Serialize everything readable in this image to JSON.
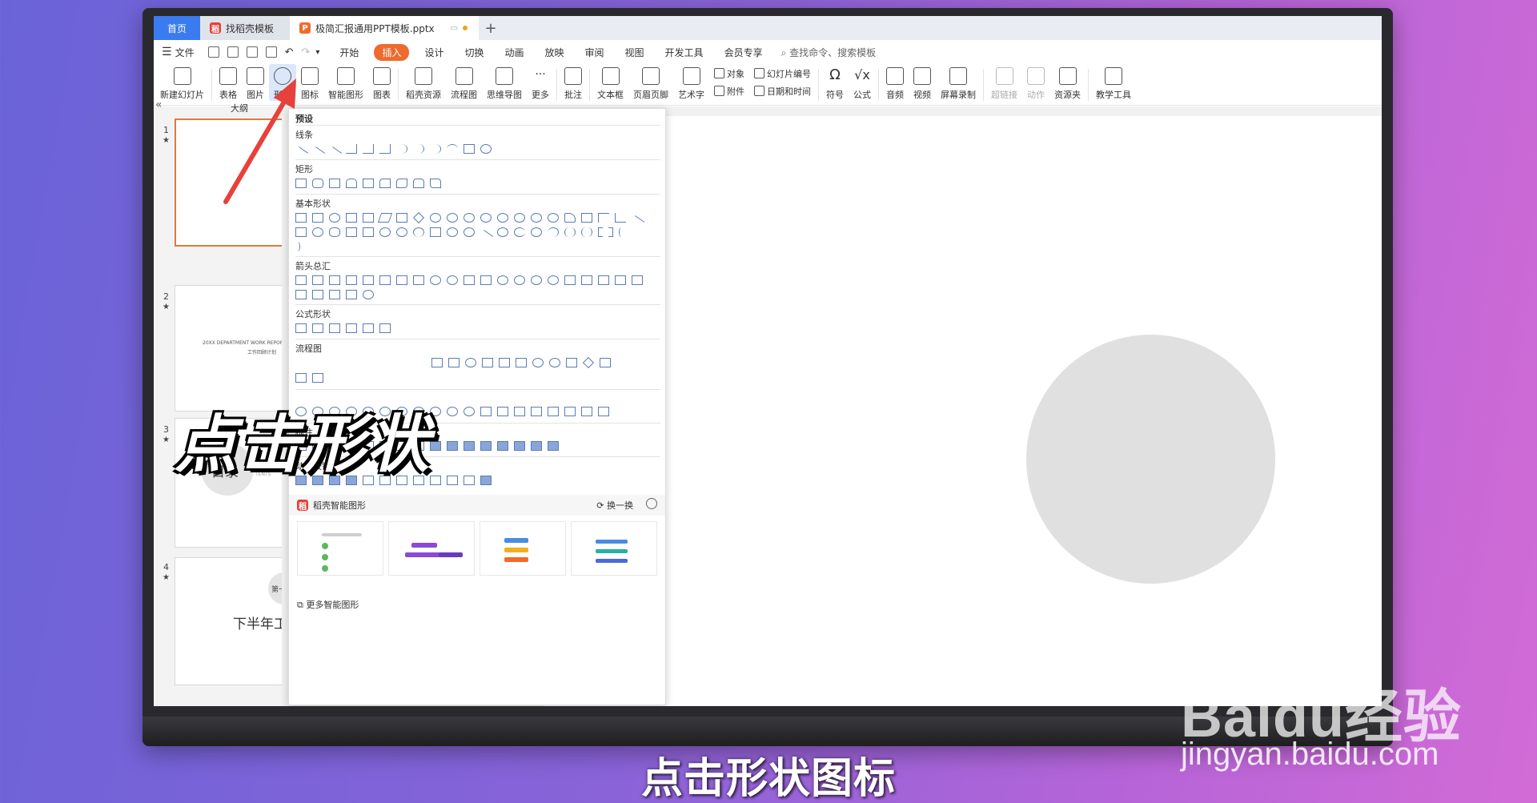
{
  "tabs": {
    "home": "首页",
    "find_template": "找稻壳模板",
    "document": "极简汇报通用PPT模板.pptx"
  },
  "menu": {
    "file": "文件",
    "items": [
      "开始",
      "插入",
      "设计",
      "切换",
      "动画",
      "放映",
      "审阅",
      "视图",
      "开发工具",
      "会员专享"
    ],
    "active": "插入",
    "search_placeholder": "查找命令、搜索模板"
  },
  "ribbon": {
    "new_slide": "新建幻灯片",
    "table": "表格",
    "picture": "图片",
    "shape": "形状",
    "icon": "图标",
    "smart_graphic": "智能图形",
    "chart": "图表",
    "docer_resource": "稻壳资源",
    "flowchart": "流程图",
    "mindmap": "思维导图",
    "more": "更多",
    "comment": "批注",
    "textbox": "文本框",
    "header_footer": "页眉页脚",
    "wordart": "艺术字",
    "object": "对象",
    "attachment": "附件",
    "slide_number": "幻灯片编号",
    "datetime": "日期和时间",
    "symbol": "符号",
    "formula": "公式",
    "audio": "音频",
    "video": "视频",
    "screen_record": "屏幕录制",
    "hyperlink": "超链接",
    "action": "动作",
    "resource_folder": "资源夹",
    "teaching_tools": "教学工具"
  },
  "left_pane": {
    "outline_tab": "大纲",
    "slides": [
      {
        "num": "1",
        "star": "★"
      },
      {
        "num": "2",
        "star": "★",
        "line1": "20XX DEPARTMENT WORK REPORT",
        "line2": "工作回顾计划"
      },
      {
        "num": "3",
        "star": "★",
        "title": "目录",
        "sub": "TENTS"
      },
      {
        "num": "4",
        "star": "★",
        "title": "下半年工",
        "badge": "第一"
      }
    ]
  },
  "shapes_dropdown": {
    "header": "预设",
    "sections": [
      "线条",
      "矩形",
      "基本形状",
      "箭头总汇",
      "公式形状",
      "流程图",
      "标注",
      "动作按钮"
    ],
    "smart_title": "稻壳智能图形",
    "swap": "换一换",
    "more_smart": "更多智能图形"
  },
  "overlay": {
    "annotation": "点击形状",
    "caption": "点击形状图标"
  },
  "watermark": {
    "logo": "Baidu经验",
    "url": "jingyan.baidu.com"
  },
  "colors": {
    "accent_orange": "#ee6a2f",
    "home_tab_blue": "#3a7bf0",
    "arrow_red": "#e8403a",
    "shape_outline": "#5b7bb5"
  }
}
